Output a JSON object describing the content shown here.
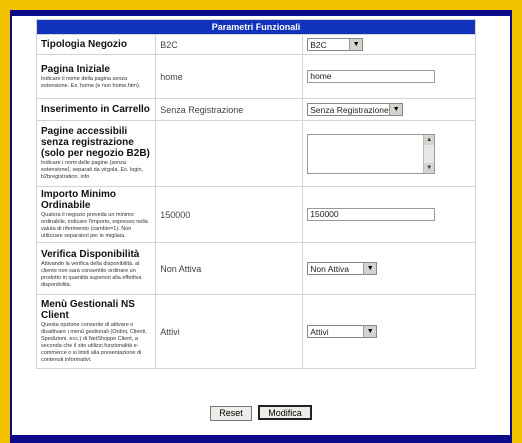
{
  "header": "Parametri Funzionali",
  "rows": [
    {
      "label": "Tipologia Negozio",
      "desc": "",
      "value": "B2C",
      "control": "select",
      "control_value": "B2C"
    },
    {
      "label": "Pagina Iniziale",
      "desc": "Indicare il nome della pagina senza estensione. Es. home (e non home.htm).",
      "value": "home",
      "control": "text",
      "control_value": "home"
    },
    {
      "label": "Inserimento in Carrello",
      "desc": "",
      "value": "Senza Registrazione",
      "control": "select",
      "control_value": "Senza Registrazione"
    },
    {
      "label": "Pagine accessibili senza registrazione (solo per negozio B2B)",
      "desc": "Indicare i nomi delle pagine (senza estensione), separati da virgola. Es. login, b2bregistration, info",
      "value": "",
      "control": "textarea",
      "control_value": ""
    },
    {
      "label": "Importo Minimo Ordinabile",
      "desc": "Qualora il negozio preveda un minimo ordinabile, indicare l'importo, espresso nella valuta di riferimento (cambio=1). Non utilizzare separatori per le migliaia.",
      "value": "150000",
      "control": "text",
      "control_value": "150000"
    },
    {
      "label": "Verifica Disponibilità",
      "desc": "Attivando la verifica della disponibilità, al cliente non sarà consentito ordinare un prodotto in quantità superiori alla effettiva disponibilità.",
      "value": "Non Attiva",
      "control": "select",
      "control_value": "Non Attiva"
    },
    {
      "label": "Menù Gestionali NS Client",
      "desc": "Questa opzione consente di attivare o disattivare i menù gestionali (Ordini, Clienti, Spedizioni, ecc.) di NetShoppe Client, a seconda che il sito utilizzi funzionalità e-commerce o si limiti alla presentazione di contenuti informativi.",
      "value": "Attivi",
      "control": "select",
      "control_value": "Attivi"
    }
  ],
  "buttons": {
    "reset": "Reset",
    "submit": "Modifica"
  },
  "colors": {
    "background": "#f2c200",
    "frame": "#0a0a8a",
    "header": "#1133bb"
  }
}
